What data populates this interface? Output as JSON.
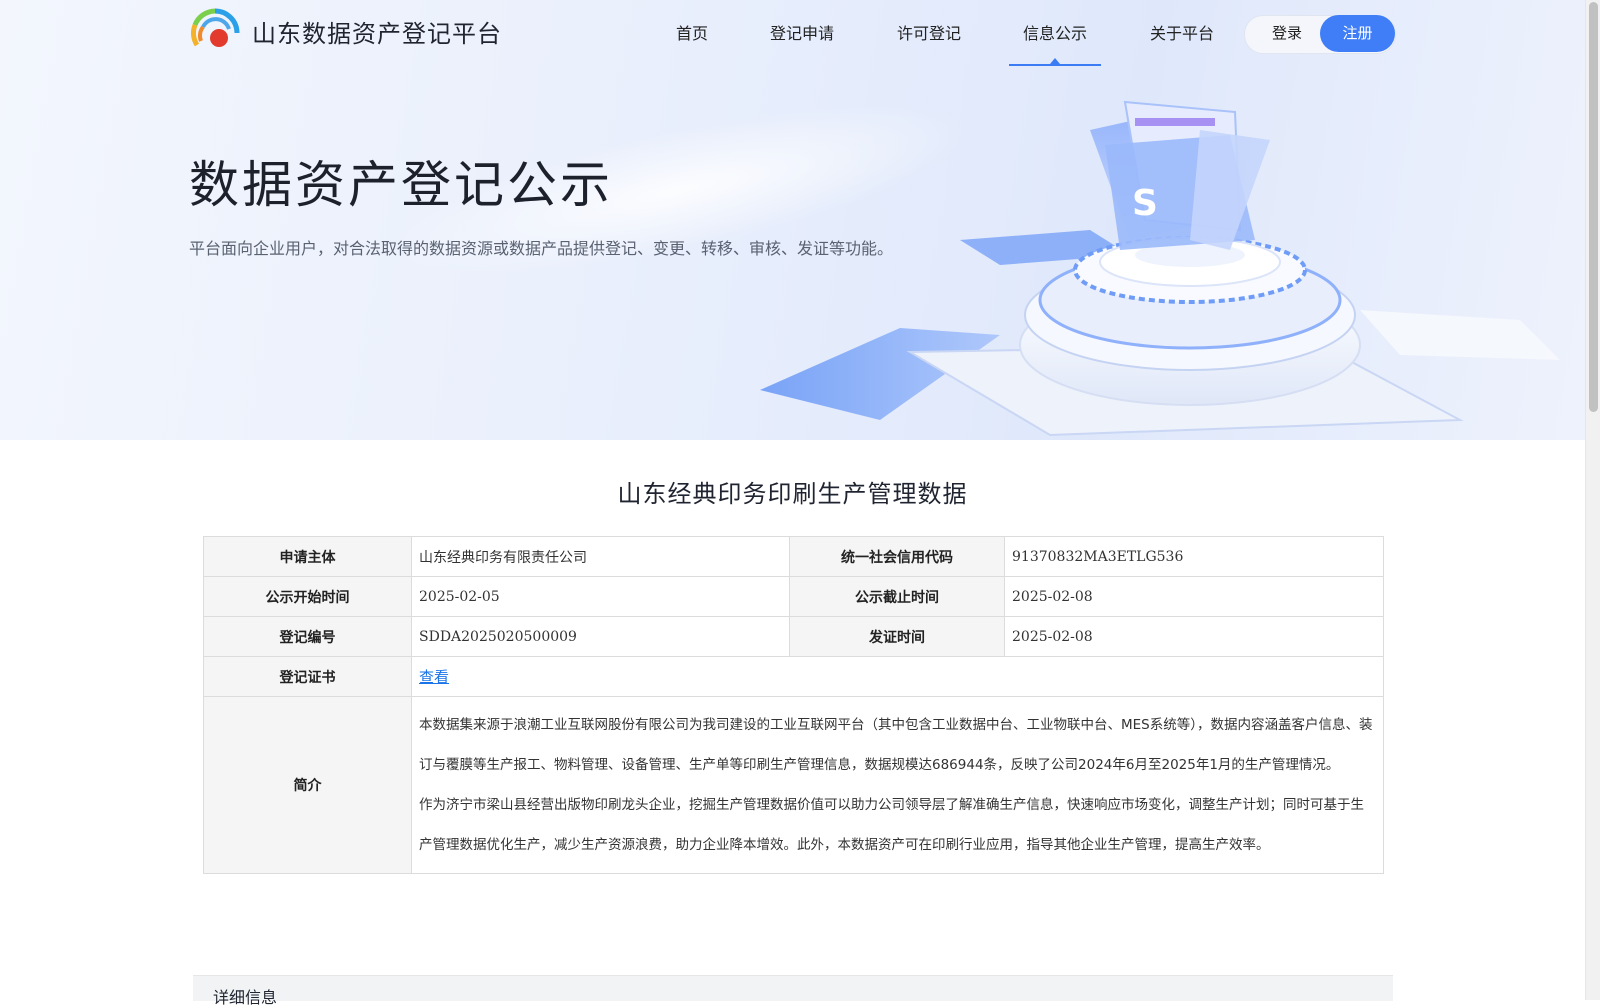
{
  "site": {
    "title": "山东数据资产登记平台"
  },
  "nav": {
    "items": [
      {
        "label": "首页",
        "active": false
      },
      {
        "label": "登记申请",
        "active": false
      },
      {
        "label": "许可登记",
        "active": false
      },
      {
        "label": "信息公示",
        "active": true
      },
      {
        "label": "关于平台",
        "active": false
      }
    ],
    "login_label": "登录",
    "register_label": "注册"
  },
  "hero": {
    "title": "数据资产登记公示",
    "description": "平台面向企业用户，对合法取得的数据资源或数据产品提供登记、变更、转移、审核、发证等功能。"
  },
  "record": {
    "title": "山东经典印务印刷生产管理数据",
    "rows": {
      "applicant_label": "申请主体",
      "applicant_value": "山东经典印务有限责任公司",
      "credit_code_label": "统一社会信用代码",
      "credit_code_value": "91370832MA3ETLG536",
      "start_label": "公示开始时间",
      "start_value": "2025-02-05",
      "end_label": "公示截止时间",
      "end_value": "2025-02-08",
      "reg_no_label": "登记编号",
      "reg_no_value": "SDDA2025020500009",
      "issue_label": "发证时间",
      "issue_value": "2025-02-08",
      "cert_label": "登记证书",
      "cert_link": "查看",
      "intro_label": "简介",
      "intro_p1": "本数据集来源于浪潮工业互联网股份有限公司为我司建设的工业互联网平台（其中包含工业数据中台、工业物联中台、MES系统等），数据内容涵盖客户信息、装订与覆膜等生产报工、物料管理、设备管理、生产单等印刷生产管理信息，数据规模达686944条，反映了公司2024年6月至2025年1月的生产管理情况。",
      "intro_p2": "作为济宁市梁山县经营出版物印刷龙头企业，挖掘生产管理数据价值可以助力公司领导层了解准确生产信息，快速响应市场变化，调整生产计划；同时可基于生产管理数据优化生产，减少生产资源浪费，助力企业降本增效。此外，本数据资产可在印刷行业应用，指导其他企业生产管理，提高生产效率。"
    }
  },
  "detail": {
    "title": "详细信息"
  },
  "colors": {
    "accent": "#3f7ef6",
    "link": "#1a73e8",
    "label_bg": "#f5f5f5"
  }
}
